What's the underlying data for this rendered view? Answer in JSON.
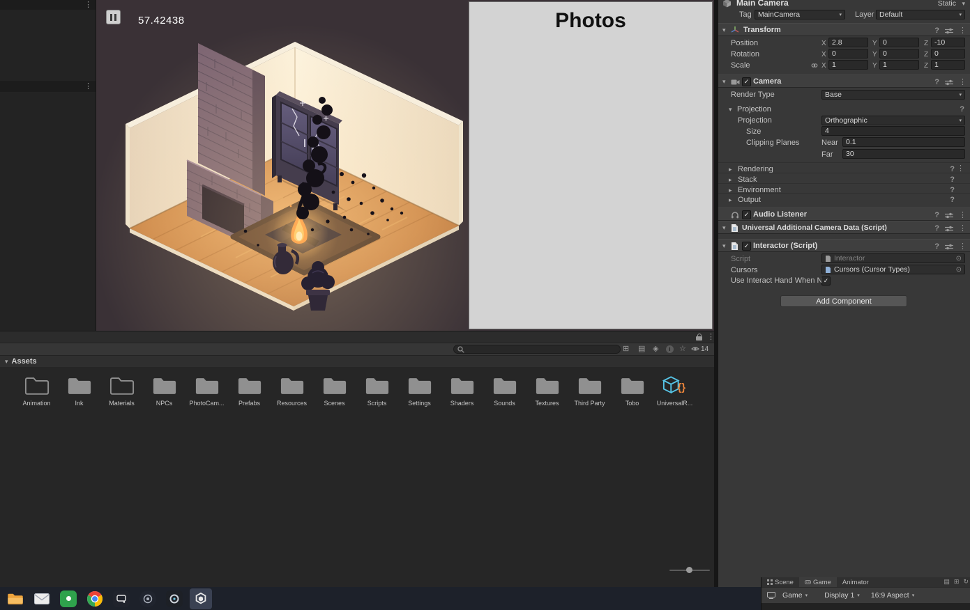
{
  "game": {
    "timer": "57.42438",
    "photos": {
      "title": "Photos"
    }
  },
  "project": {
    "header": "Assets",
    "visible_count": "14",
    "folders": [
      {
        "label": "Animation"
      },
      {
        "label": "Ink"
      },
      {
        "label": "Materials"
      },
      {
        "label": "NPCs"
      },
      {
        "label": "PhotoCam..."
      },
      {
        "label": "Prefabs"
      },
      {
        "label": "Resources"
      },
      {
        "label": "Scenes"
      },
      {
        "label": "Scripts"
      },
      {
        "label": "Settings"
      },
      {
        "label": "Shaders"
      },
      {
        "label": "Sounds"
      },
      {
        "label": "Textures"
      },
      {
        "label": "Third Party"
      },
      {
        "label": "Tobo"
      }
    ],
    "package": {
      "label": "UniversalR..."
    }
  },
  "inspector": {
    "gameobject": {
      "name": "Main Camera",
      "static_label": "Static"
    },
    "tags": {
      "tag_label": "Tag",
      "tag_value": "MainCamera",
      "layer_label": "Layer",
      "layer_value": "Default"
    },
    "axes": {
      "x": "X",
      "y": "Y",
      "z": "Z"
    },
    "transform": {
      "title": "Transform",
      "rows": [
        {
          "label": "Position",
          "x": "2.8",
          "y": "0",
          "z": "-10"
        },
        {
          "label": "Rotation",
          "x": "0",
          "y": "0",
          "z": "0"
        },
        {
          "label": "Scale",
          "x": "1",
          "y": "1",
          "z": "1"
        }
      ]
    },
    "camera": {
      "title": "Camera",
      "render_type_label": "Render Type",
      "render_type_value": "Base",
      "projection_header": "Projection",
      "projection_label": "Projection",
      "projection_value": "Orthographic",
      "size_label": "Size",
      "size_value": "4",
      "clipping_label": "Clipping Planes",
      "near_label": "Near",
      "near_value": "0.1",
      "far_label": "Far",
      "far_value": "30",
      "foldouts": [
        {
          "label": "Rendering"
        },
        {
          "label": "Stack"
        },
        {
          "label": "Environment"
        },
        {
          "label": "Output"
        }
      ]
    },
    "audio_listener": {
      "title": "Audio Listener"
    },
    "camera_data": {
      "title": "Universal Additional Camera Data (Script)"
    },
    "interactor": {
      "title": "Interactor (Script)",
      "script_label": "Script",
      "script_value": "Interactor",
      "cursors_label": "Cursors",
      "cursors_value": "Cursors (Cursor Types)",
      "hand_label": "Use Interact Hand When N..."
    },
    "add_component_label": "Add Component"
  },
  "bottom_window": {
    "tabs": [
      {
        "label": "Scene"
      },
      {
        "label": "Game"
      },
      {
        "label": "Animator"
      }
    ],
    "toolbar": {
      "game": "Game",
      "display": "Display 1",
      "aspect": "16:9 Aspect"
    }
  },
  "colors": {
    "package_cyan": "#57c6e8",
    "brace_orange": "#e8833a"
  }
}
